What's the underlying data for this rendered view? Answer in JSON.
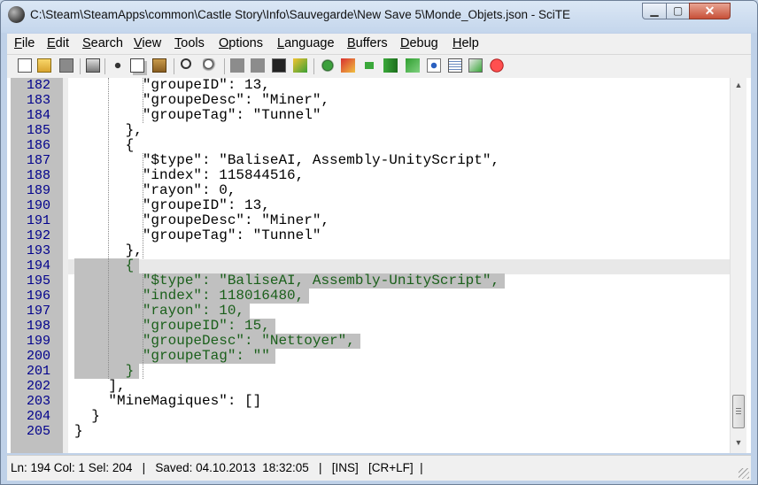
{
  "window": {
    "title": "C:\\Steam\\SteamApps\\common\\Castle Story\\Info\\Sauvegarde\\New Save 5\\Monde_Objets.json - SciTE",
    "controls": {
      "minimize": "▁",
      "maximize": "▢",
      "close": "✕"
    }
  },
  "menu": [
    {
      "key": "F",
      "rest": "ile"
    },
    {
      "key": "E",
      "rest": "dit"
    },
    {
      "key": "S",
      "rest": "earch"
    },
    {
      "key": "V",
      "rest": "iew"
    },
    {
      "key": "T",
      "rest": "ools"
    },
    {
      "key": "O",
      "rest": "ptions"
    },
    {
      "key": "L",
      "rest": "anguage"
    },
    {
      "key": "B",
      "rest": "uffers"
    },
    {
      "key": "D",
      "rest": "ebug"
    },
    {
      "key": "H",
      "rest": "elp"
    }
  ],
  "toolbar": [
    "new-file-icon",
    "open-folder-icon",
    "save-icon",
    "print-icon",
    "cut-icon",
    "copy-icon",
    "paste-icon",
    "find-icon",
    "replace-icon",
    "block-gray-icon",
    "block-gray2-icon",
    "terminal-icon",
    "build-icon",
    "compile-icon",
    "bookmark-icon",
    "go-icon",
    "next-message-icon",
    "jump-icon",
    "view-icon",
    "properties-icon",
    "export-icon",
    "stop-icon"
  ],
  "editor": {
    "lines": [
      {
        "num": "182",
        "text": "        \"groupeID\": 13,",
        "sel": false
      },
      {
        "num": "183",
        "text": "        \"groupeDesc\": \"Miner\",",
        "sel": false
      },
      {
        "num": "184",
        "text": "        \"groupeTag\": \"Tunnel\"",
        "sel": false
      },
      {
        "num": "185",
        "text": "      },",
        "sel": false
      },
      {
        "num": "186",
        "text": "      {",
        "sel": false
      },
      {
        "num": "187",
        "text": "        \"$type\": \"BaliseAI, Assembly-UnityScript\",",
        "sel": false
      },
      {
        "num": "188",
        "text": "        \"index\": 115844516,",
        "sel": false
      },
      {
        "num": "189",
        "text": "        \"rayon\": 0,",
        "sel": false
      },
      {
        "num": "190",
        "text": "        \"groupeID\": 13,",
        "sel": false
      },
      {
        "num": "191",
        "text": "        \"groupeDesc\": \"Miner\",",
        "sel": false
      },
      {
        "num": "192",
        "text": "        \"groupeTag\": \"Tunnel\"",
        "sel": false
      },
      {
        "num": "193",
        "text": "      },",
        "sel": false
      },
      {
        "num": "194",
        "text": "      {",
        "sel": true
      },
      {
        "num": "195",
        "text": "        \"$type\": \"BaliseAI, Assembly-UnityScript\",",
        "sel": true
      },
      {
        "num": "196",
        "text": "        \"index\": 118016480,",
        "sel": true
      },
      {
        "num": "197",
        "text": "        \"rayon\": 10,",
        "sel": true
      },
      {
        "num": "198",
        "text": "        \"groupeID\": 15,",
        "sel": true
      },
      {
        "num": "199",
        "text": "        \"groupeDesc\": \"Nettoyer\",",
        "sel": true
      },
      {
        "num": "200",
        "text": "        \"groupeTag\": \"\"",
        "sel": true
      },
      {
        "num": "201",
        "text": "      }",
        "sel": true
      },
      {
        "num": "202",
        "text": "    ],",
        "sel": false
      },
      {
        "num": "203",
        "text": "    \"MineMagiques\": []",
        "sel": false
      },
      {
        "num": "204",
        "text": "  }",
        "sel": false
      },
      {
        "num": "205",
        "text": "}",
        "sel": false
      }
    ],
    "colors": {
      "selected_text": "#1a5f1a",
      "line_numbers": "#00008b",
      "selection": "#c0c0c0"
    }
  },
  "status": {
    "text": "Ln: 194 Col: 1 Sel: 204   |   Saved: 04.10.2013  18:32:05   |   [INS]   [CR+LF]  |"
  }
}
